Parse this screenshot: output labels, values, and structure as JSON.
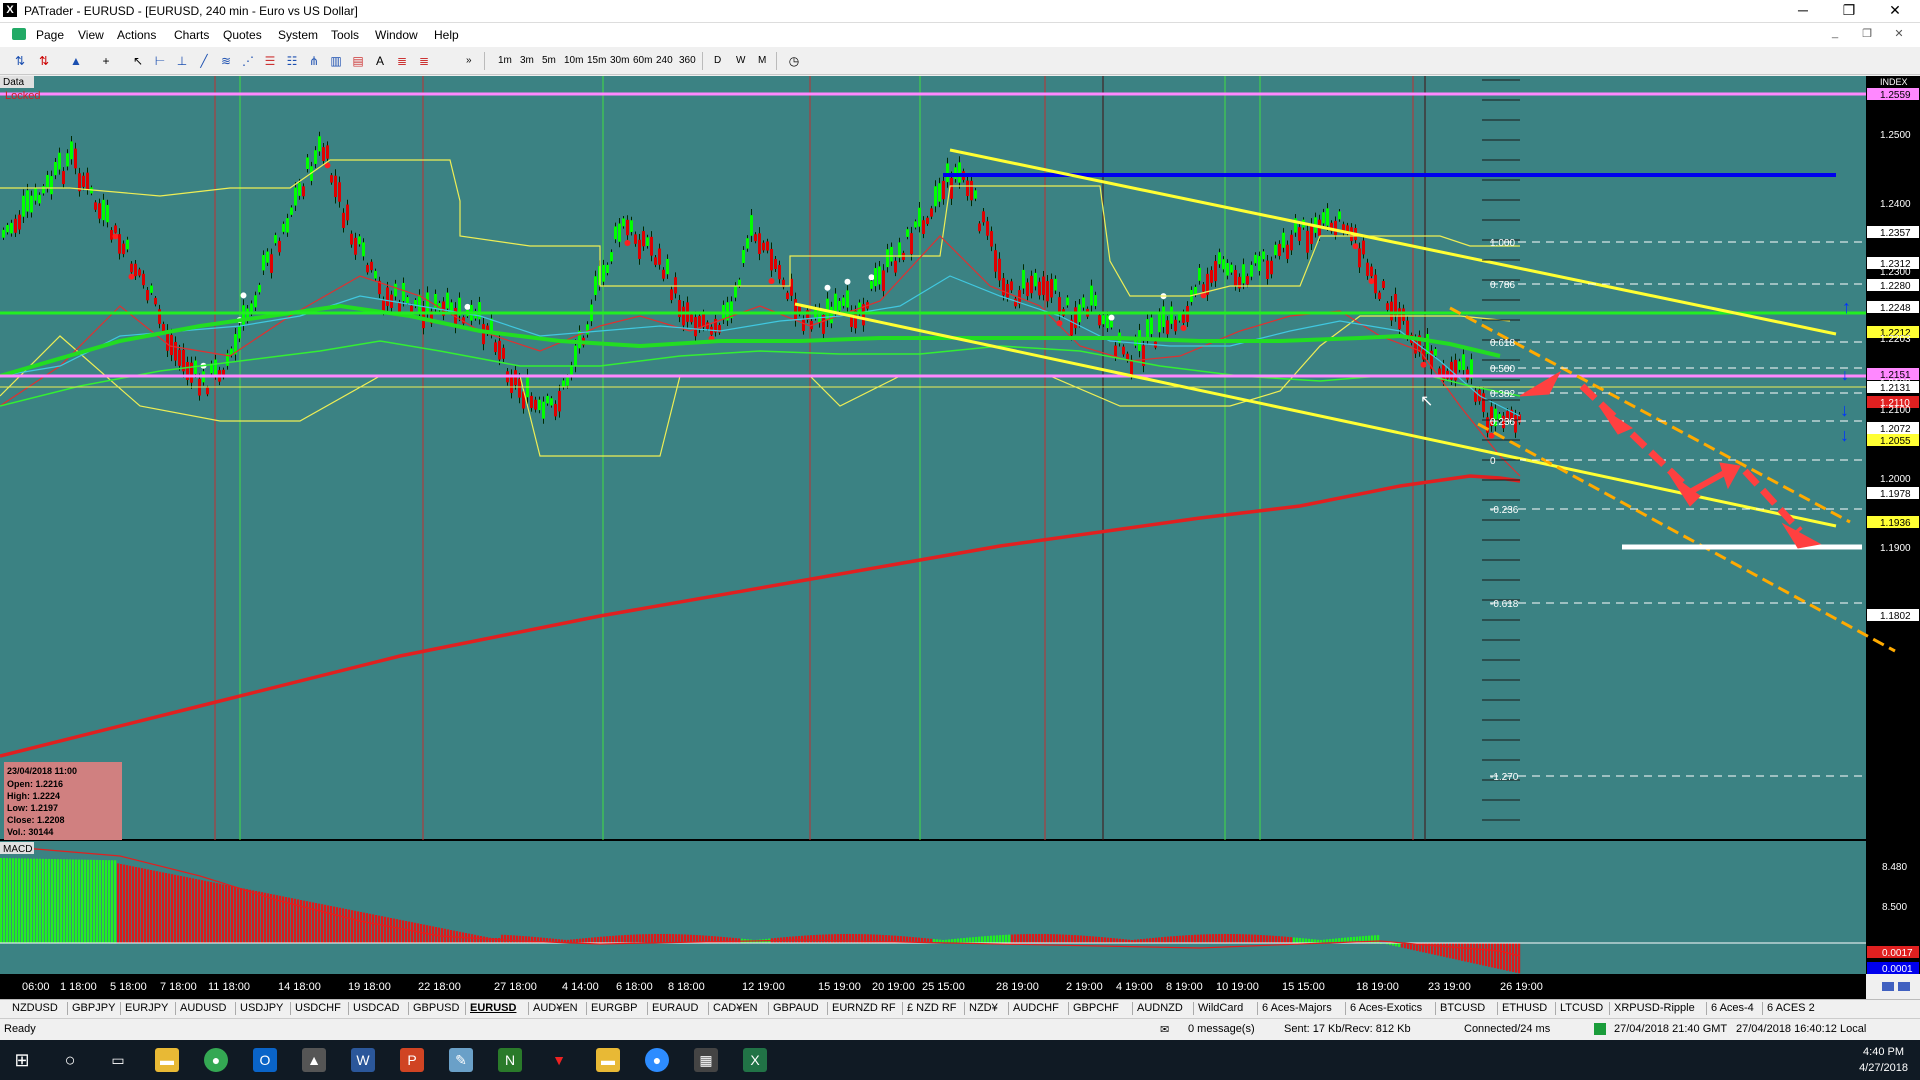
{
  "window": {
    "title": "PATrader - EURUSD - [EURUSD, 240 min - Euro vs US Dollar]",
    "app_icon": "X",
    "minimize": "─",
    "maximize": "❐",
    "close": "✕"
  },
  "menu": [
    "Page",
    "View",
    "Actions",
    "Charts",
    "Quotes",
    "System",
    "Tools",
    "Window",
    "Help"
  ],
  "mdi": {
    "min": "_",
    "restore": "❐",
    "close": "✕"
  },
  "toolbar": {
    "timeframes": [
      "1m",
      "3m",
      "5m",
      "10m",
      "15m",
      "30m",
      "60m",
      "240",
      "360"
    ],
    "periods": [
      "D",
      "W",
      "M"
    ],
    "more": "»"
  },
  "chart": {
    "labels": {
      "data": "Data",
      "locked": "Locked",
      "index": "INDEX",
      "macd": "MACD"
    },
    "price_axis": [
      "1.2559",
      "1.2500",
      "1.2400",
      "1.2357",
      "1.2312",
      "1.2300",
      "1.2280",
      "1.2248",
      "1.2212",
      "1.2203",
      "1.2151",
      "1.2139",
      "1.2131",
      "1.2110",
      "1.2100",
      "1.2072",
      "1.2055",
      "1.2000",
      "1.1978",
      "1.1936",
      "1.1900",
      "1.1802"
    ],
    "macd_axis": [
      "8.480",
      "8.500",
      "0.0017",
      "0.0001"
    ],
    "fib_labels": [
      "1.000",
      "0.786",
      "0.618",
      "0.500",
      "0.382",
      "0.236",
      "0",
      "-0.236",
      "-0.618",
      "-1.270"
    ],
    "time_axis": [
      "06:00",
      "1 18:00",
      "5 18:00",
      "7 18:00",
      "11 18:00",
      "14 18:00",
      "19 18:00",
      "22 18:00",
      "27 18:00",
      "4 14:00",
      "6 18:00",
      "8 18:00",
      "12 19:00",
      "15 19:00",
      "20 19:00",
      "25 15:00",
      "28 19:00",
      "2 19:00",
      "4 19:00",
      "8 19:00",
      "10 19:00",
      "15 15:00",
      "18 19:00",
      "23 19:00",
      "26 19:00"
    ],
    "info_box": {
      "date": "23/04/2018 11:00",
      "open": "Open: 1.2216",
      "high": "High: 1.2224",
      "low": "Low: 1.2197",
      "close": "Close: 1.2208",
      "vol": "Vol.: 30144"
    },
    "colors": {
      "background": "#3b8283",
      "bull": "#00ff00",
      "bear": "#e00000",
      "channel": "#ffff33",
      "forecast": "#ff4040",
      "zone": "#ffaa00",
      "resistance": "#0000ff",
      "pink": "#ff88ff"
    }
  },
  "tabs": [
    "NZDUSD",
    "GBPJPY",
    "EURJPY",
    "AUDUSD",
    "USDJPY",
    "USDCHF",
    "USDCAD",
    "GBPUSD",
    "EURUSD",
    "AUD¥EN",
    "EURGBP",
    "EURAUD",
    "CAD¥EN",
    "GBPAUD",
    "EURNZD RF",
    "£ NZD RF",
    "NZD¥",
    "AUDCHF",
    "GBPCHF",
    "AUDNZD",
    "WildCard",
    "6 Aces-Majors",
    "6 Aces-Exotics",
    "BTCUSD",
    "ETHUSD",
    "LTCUSD",
    "XRPUSD-Ripple",
    "6 Aces-4",
    "6 ACES 2"
  ],
  "active_tab": "EURUSD",
  "status": {
    "ready": "Ready",
    "messages": "0 message(s)",
    "traffic": "Sent: 17 Kb/Recv: 812 Kb",
    "connection": "Connected/24 ms",
    "gmt": "27/04/2018 21:40 GMT",
    "local": "27/04/2018 16:40:12 Local"
  },
  "taskbar": {
    "time": "4:40 PM",
    "date": "4/27/2018"
  }
}
